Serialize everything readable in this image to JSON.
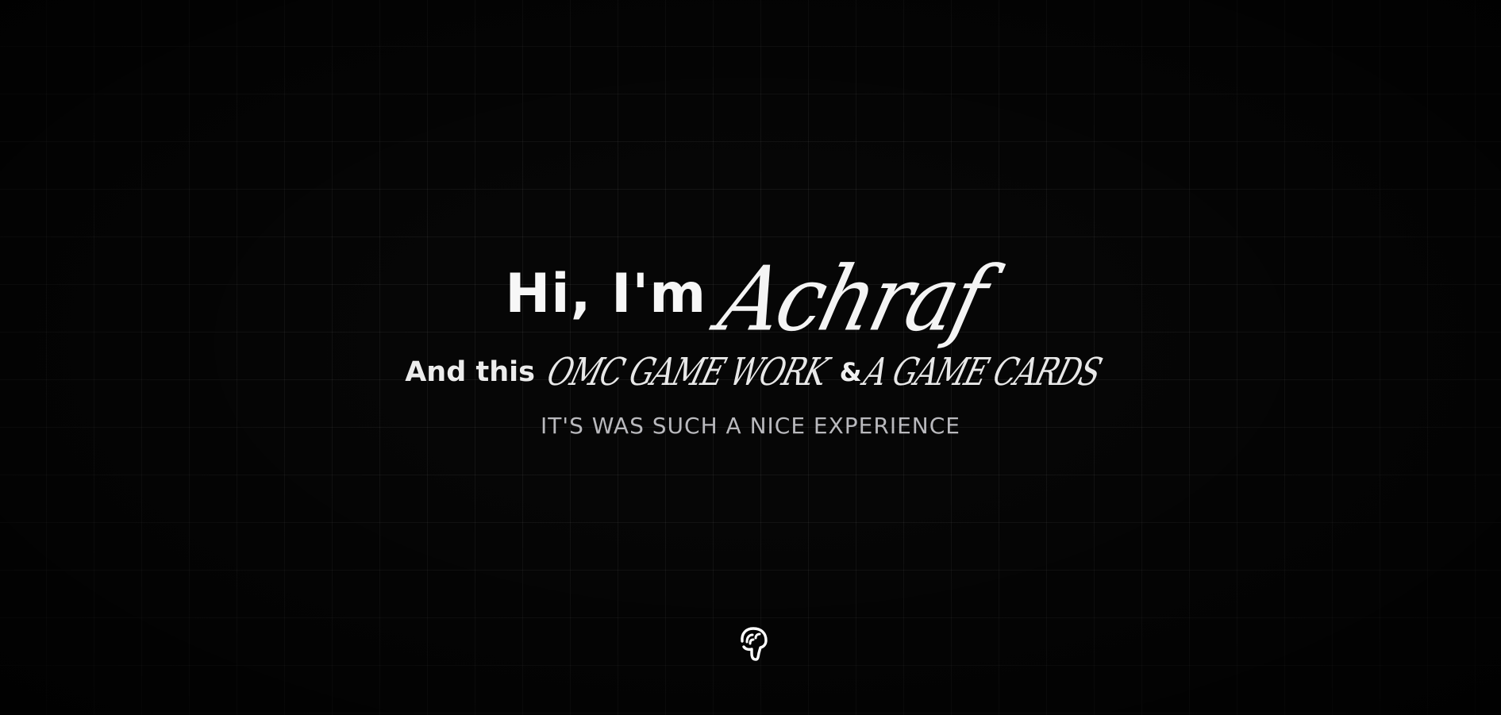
{
  "hero": {
    "greeting": "Hi, I'm",
    "name": "Achraf",
    "intro": "And this",
    "project_1": "OMC GAME WORK",
    "ampersand": "&",
    "project_2": "A GAME CARDS",
    "tagline": "IT'S WAS SUCH A NICE EXPERIENCE"
  },
  "scroll_hint": {
    "icon": "pointing-down-hand-icon"
  },
  "colors": {
    "background": "#060606",
    "grid_line": "#1a1a1a",
    "primary_text": "#f7f7f7",
    "muted_text": "#b9b9bd"
  }
}
